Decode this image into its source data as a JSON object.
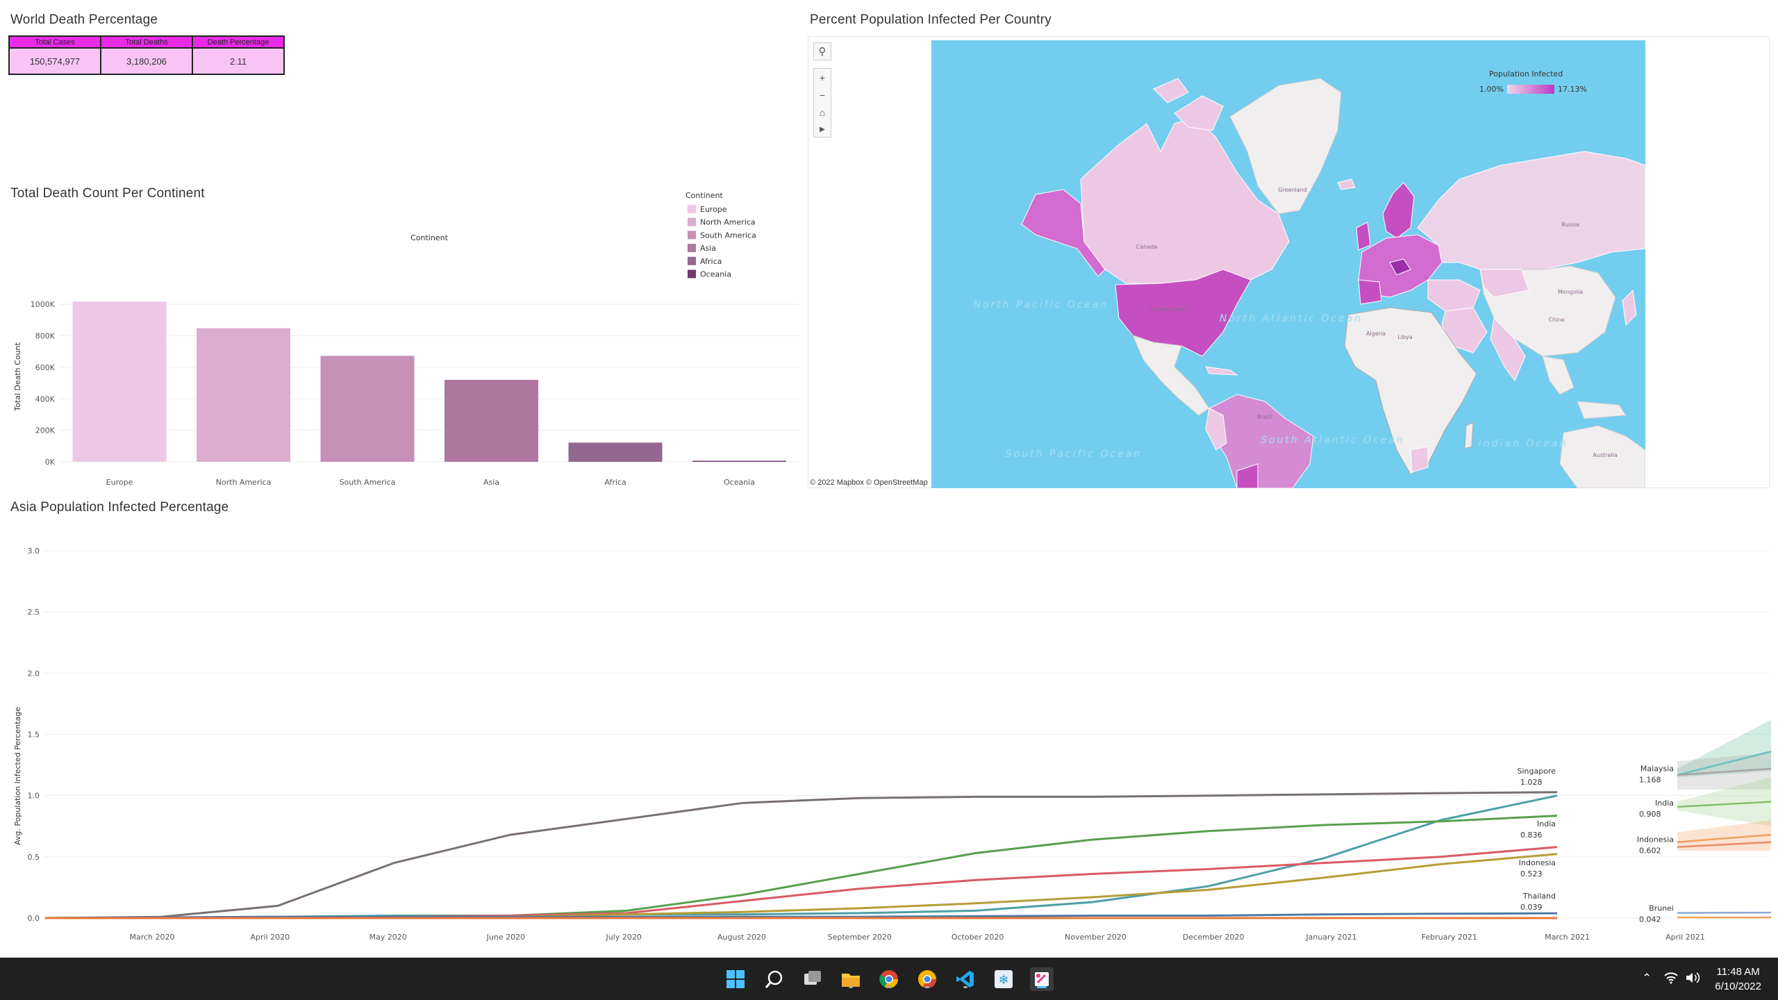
{
  "titles": {
    "world_death": "World Death Percentage",
    "continent": "Total Death Count Per Continent",
    "map": "Percent Population Infected Per Country",
    "asia": "Asia  Population Infected Percentage"
  },
  "kpi": {
    "headers": [
      "Total Cases",
      "Total Deaths",
      "Death Percentage"
    ],
    "values": [
      "150,574,977",
      "3,180,206",
      "2.11"
    ]
  },
  "colors": {
    "kpi_header": "#e92be8",
    "kpi_cell": "#f8c4f6",
    "ocean": "#73cdee",
    "infected_low": "#f1d5ee",
    "infected_high": "#b63cc4"
  },
  "chart_data": [
    {
      "type": "bar",
      "title": "Total Death Count Per Continent",
      "xlabel": "Continent",
      "ylabel": "Total Death Count",
      "categories": [
        "Europe",
        "North America",
        "South America",
        "Asia",
        "Africa",
        "Oceania"
      ],
      "values": [
        1016750,
        847942,
        672415,
        520269,
        121784,
        1046
      ],
      "bar_colors": [
        "#edc8e4",
        "#dcadcc",
        "#c68fb5",
        "#af779d",
        "#936790",
        "#6d3a6a"
      ],
      "yticks": [
        0,
        200000,
        400000,
        600000,
        800000,
        1000000
      ],
      "ytick_labels": [
        "0K",
        "200K",
        "400K",
        "600K",
        "800K",
        "1000K"
      ],
      "ylim": [
        0,
        1080000
      ],
      "grid": true,
      "legend": {
        "title": "Continent",
        "position": "top-right",
        "items": [
          "Europe",
          "North America",
          "South America",
          "Asia",
          "Africa",
          "Oceania"
        ]
      }
    },
    {
      "type": "line",
      "title": "Asia  Population Infected Percentage",
      "ylabel": "Avg. Population Infected Percentage",
      "x": [
        "2020-02",
        "2020-03",
        "2020-04",
        "2020-05",
        "2020-06",
        "2020-07",
        "2020-08",
        "2020-09",
        "2020-10",
        "2020-11",
        "2020-12",
        "2021-01",
        "2021-02",
        "2021-03"
      ],
      "xtick_labels": [
        "March 2020",
        "April 2020",
        "May 2020",
        "June 2020",
        "July 2020",
        "August 2020",
        "September 2020",
        "October 2020",
        "November 2020",
        "December 2020",
        "January 2021",
        "February 2021",
        "March 2021",
        "April 2021"
      ],
      "ylim": [
        0,
        3.0
      ],
      "yticks": [
        0.0,
        0.5,
        1.0,
        1.5,
        2.0,
        2.5,
        3.0
      ],
      "grid": true,
      "series": [
        {
          "name": "Singapore",
          "color": "#787070",
          "values": [
            0.0,
            0.01,
            0.1,
            0.45,
            0.68,
            0.81,
            0.94,
            0.98,
            0.99,
            0.99,
            1.0,
            1.01,
            1.02,
            1.028
          ]
        },
        {
          "name": "Malaysia",
          "color": "#4d9fa5",
          "values": [
            0.0,
            0.005,
            0.01,
            0.02,
            0.02,
            0.03,
            0.03,
            0.04,
            0.06,
            0.13,
            0.26,
            0.49,
            0.8,
            1.0
          ]
        },
        {
          "name": "India",
          "color": "#58a04e",
          "values": [
            0.0,
            0.0,
            0.0,
            0.01,
            0.02,
            0.06,
            0.19,
            0.36,
            0.53,
            0.64,
            0.71,
            0.76,
            0.79,
            0.836
          ]
        },
        {
          "name": "Indonesia",
          "color": "#d95a63",
          "values": [
            0.0,
            0.0,
            0.0,
            0.01,
            0.02,
            0.04,
            0.14,
            0.24,
            0.31,
            0.36,
            0.4,
            0.45,
            0.5,
            0.58
          ]
        },
        {
          "name": "Indonesia",
          "color": "#b69d36",
          "values": [
            0.0,
            0.0,
            0.0,
            0.0,
            0.01,
            0.03,
            0.05,
            0.08,
            0.12,
            0.17,
            0.23,
            0.33,
            0.44,
            0.523
          ]
        },
        {
          "name": "Thailand",
          "color": "#4e79a7",
          "values": [
            0.0,
            0.005,
            0.01,
            0.01,
            0.01,
            0.01,
            0.01,
            0.01,
            0.015,
            0.02,
            0.02,
            0.03,
            0.035,
            0.039
          ]
        },
        {
          "name": "Brunei",
          "color": "#e8773a",
          "values": [
            0.0,
            0.0,
            0.0,
            0.0,
            0.0,
            0.0,
            0.0,
            0.0,
            0.0,
            0.0,
            0.0,
            0.0,
            0.0,
            0.0
          ]
        }
      ],
      "end_labels": [
        {
          "name": "Singapore",
          "value": "1.028"
        },
        {
          "name": "India",
          "value": "0.836"
        },
        {
          "name": "Indonesia",
          "value": "0.523"
        },
        {
          "name": "Thailand",
          "value": "0.039"
        }
      ],
      "forecast_labels": [
        {
          "name": "Malaysia",
          "value": "1.168"
        },
        {
          "name": "India",
          "value": "0.908"
        },
        {
          "name": "Indonesia",
          "value": "0.602"
        },
        {
          "name": "Brunei",
          "value": "0.042"
        }
      ]
    }
  ],
  "map": {
    "legend_title": "Population Infected",
    "legend_min": "1.00%",
    "legend_max": "17.13%",
    "attribution": "© 2022 Mapbox  © OpenStreetMap",
    "labels": [
      {
        "text": "North Pacific Ocean"
      },
      {
        "text": "North Atlantic Ocean"
      },
      {
        "text": "South Pacific Ocean"
      },
      {
        "text": "South Atlantic Ocean"
      },
      {
        "text": "Indian Ocean"
      },
      {
        "text": "Greenland"
      },
      {
        "text": "Canada"
      },
      {
        "text": "United States"
      },
      {
        "text": "Brazil"
      },
      {
        "text": "Russia"
      },
      {
        "text": "China"
      },
      {
        "text": "Mongolia"
      },
      {
        "text": "Australia"
      },
      {
        "text": "Algeria"
      },
      {
        "text": "Libya"
      }
    ],
    "tools": [
      "search-icon",
      "zoom-in-icon",
      "zoom-out-icon",
      "home-icon",
      "play-icon"
    ]
  },
  "taskbar": {
    "time": "11:48 AM",
    "date": "6/10/2022",
    "apps": [
      "windows-start-icon",
      "search-icon",
      "task-view-icon",
      "file-explorer-icon",
      "chrome-icon",
      "chrome-canary-icon",
      "vscode-icon",
      "snowflake-icon",
      "snipping-tool-icon"
    ]
  }
}
